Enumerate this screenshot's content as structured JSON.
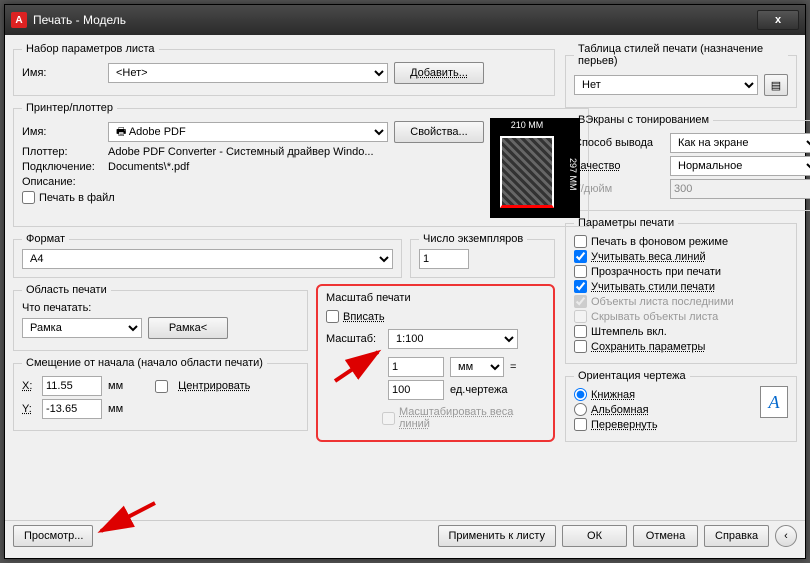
{
  "title": "Печать - Модель",
  "close": "x",
  "pageSet": {
    "legend": "Набор параметров листа",
    "nameLabel": "Имя:",
    "nameValue": "<Нет>",
    "addBtn": "Добавить..."
  },
  "printer": {
    "legend": "Принтер/плоттер",
    "nameLabel": "Имя:",
    "nameValue": "Adobe PDF",
    "propsBtn": "Свойства...",
    "plotterLabel": "Плоттер:",
    "plotterValue": "Adobe PDF Converter - Системный драйвер Windo...",
    "whereLabel": "Подключение:",
    "whereValue": "Documents\\*.pdf",
    "descLabel": "Описание:",
    "toFile": "Печать в файл",
    "dimTop": "210 MM",
    "dimRight": "297 MM"
  },
  "format": {
    "legend": "Формат",
    "value": "A4"
  },
  "copies": {
    "legend": "Число экземпляров",
    "value": "1"
  },
  "area": {
    "legend": "Область печати",
    "whatLabel": "Что печатать:",
    "whatValue": "Рамка",
    "windowBtn": "Рамка<"
  },
  "offset": {
    "legend": "Смещение от начала (начало области печати)",
    "xLabel": "X:",
    "xValue": "11.55",
    "yLabel": "Y:",
    "yValue": "-13.65",
    "unit": "мм",
    "center": "Центрировать"
  },
  "scale": {
    "legend": "Масштаб печати",
    "fit": "Вписать",
    "scaleLabel": "Масштаб:",
    "scaleValue": "1:100",
    "unit1": "1",
    "unitSel": "мм",
    "unit2": "100",
    "unit2Label": "ед.чертежа",
    "lw": "Масштабировать веса линий"
  },
  "styles": {
    "legend": "Таблица стилей печати (назначение перьев)",
    "value": "Нет"
  },
  "shade": {
    "legend": "ВЭкраны с тонированием",
    "modeLabel": "Способ вывода",
    "modeValue": "Как на экране",
    "qualLabel": "Качество",
    "qualValue": "Нормальное",
    "dpiLabel": "Т/дюйм",
    "dpiValue": "300"
  },
  "options": {
    "legend": "Параметры печати",
    "bg": "Печать в фоновом режиме",
    "lw": "Учитывать веса линий",
    "tr": "Прозрачность при печати",
    "st": "Учитывать стили печати",
    "last": "Объекты листа последними",
    "hide": "Скрывать объекты листа",
    "stamp": "Штемпель вкл.",
    "save": "Сохранить параметры"
  },
  "orient": {
    "legend": "Ориентация чертежа",
    "portrait": "Книжная",
    "landscape": "Альбомная",
    "upside": "Перевернуть"
  },
  "footer": {
    "preview": "Просмотр...",
    "apply": "Применить к листу",
    "ok": "ОК",
    "cancel": "Отмена",
    "help": "Справка"
  }
}
